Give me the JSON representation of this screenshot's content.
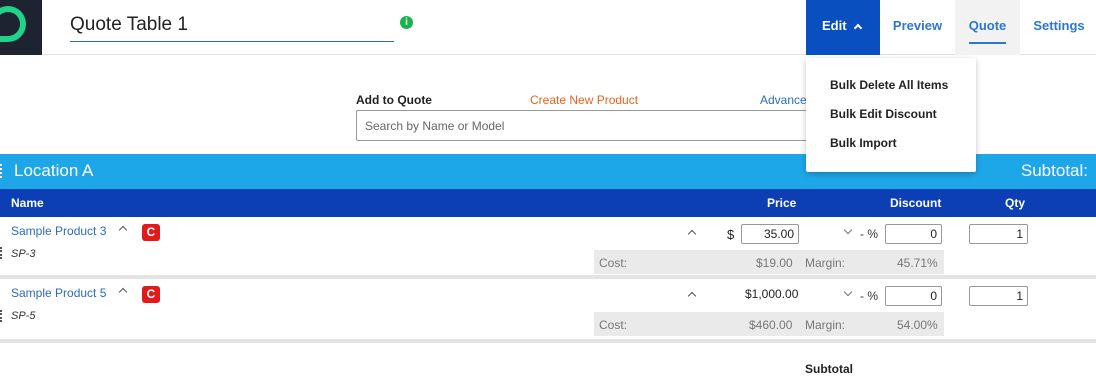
{
  "header": {
    "title": "Quote Table 1",
    "info_icon": "i",
    "tabs": {
      "edit": "Edit",
      "preview": "Preview",
      "quote": "Quote",
      "settings": "Settings"
    },
    "logo_color": "#1fd38a"
  },
  "edit_menu": {
    "items": [
      "Bulk Delete All Items",
      "Bulk Edit Discount",
      "Bulk Import"
    ]
  },
  "add_to_quote": {
    "label": "Add to Quote",
    "create_link": "Create New Product",
    "advanced_link": "Advance",
    "search_placeholder": "Search by Name or Model"
  },
  "location": {
    "name": "Location A",
    "subtotal_label": "Subtotal:"
  },
  "columns": {
    "name": "Name",
    "price": "Price",
    "discount": "Discount",
    "qty": "Qty"
  },
  "rows": [
    {
      "name": "Sample Product 3",
      "badge": "C",
      "sku": "SP-3",
      "currency": "$",
      "price": "35.00",
      "discount_sign": "- %",
      "discount": "0",
      "qty": "1",
      "cost_label": "Cost:",
      "cost": "$19.00",
      "margin_label": "Margin:",
      "margin": "45.71%"
    },
    {
      "name": "Sample Product 5",
      "badge": "C",
      "sku": "SP-5",
      "price": "$1,000.00",
      "discount_sign": "- %",
      "discount": "0",
      "qty": "1",
      "cost_label": "Cost:",
      "cost": "$460.00",
      "margin_label": "Margin:",
      "margin": "54.00%"
    }
  ],
  "footer": {
    "subtotal": "Subtotal"
  },
  "colors": {
    "edit_tab": "#0a4fbf",
    "location_bar": "#1ea7e8",
    "column_header": "#0c3fb3",
    "badge": "#e11b1b",
    "create_link": "#e8641c"
  }
}
